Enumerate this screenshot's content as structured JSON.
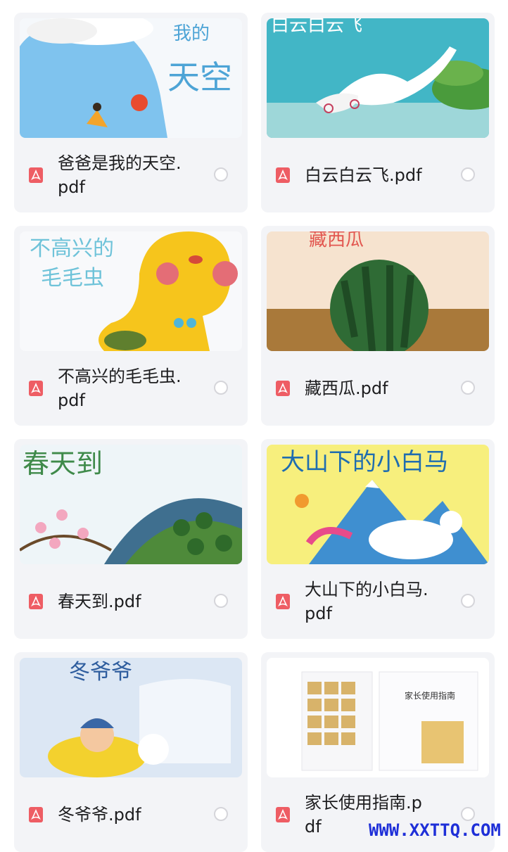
{
  "files": [
    {
      "name": "爸爸是我的天空.pdf",
      "cover_title": "我的 天空",
      "thumb_bg": "#cfe4f1",
      "accent": "#4aa3df"
    },
    {
      "name": "白云白云飞.pdf",
      "cover_title": "白云白云飞",
      "thumb_bg": "#3db7c9",
      "accent": "#ffffff"
    },
    {
      "name": "不高兴的毛毛虫.pdf",
      "cover_title": "不高兴的 毛毛虫",
      "thumb_bg": "#f7f8fa",
      "accent": "#f7c418"
    },
    {
      "name": "藏西瓜.pdf",
      "cover_title": "藏西瓜",
      "thumb_bg": "#f5e4cf",
      "accent": "#2e6b36"
    },
    {
      "name": "春天到.pdf",
      "cover_title": "春天到",
      "thumb_bg": "#eaf3f7",
      "accent": "#2d7c3e"
    },
    {
      "name": "大山下的小白马.pdf",
      "cover_title": "大山下的小白马",
      "thumb_bg": "#f7ef7a",
      "accent": "#3e8fd0"
    },
    {
      "name": "冬爷爷.pdf",
      "cover_title": "冬爷爷",
      "thumb_bg": "#dde8f5",
      "accent": "#f0cf27"
    },
    {
      "name": "家长使用指南.pdf",
      "cover_title": "家长使用指南",
      "thumb_bg": "#ffffff",
      "accent": "#e5b94b"
    }
  ],
  "watermark": "WWW.XXTTQ.COM",
  "colors": {
    "card_bg": "#f3f4f7",
    "pdf_icon": "#ee5d64",
    "radio_border": "#d5d5da",
    "watermark": "#1e2fd8"
  }
}
